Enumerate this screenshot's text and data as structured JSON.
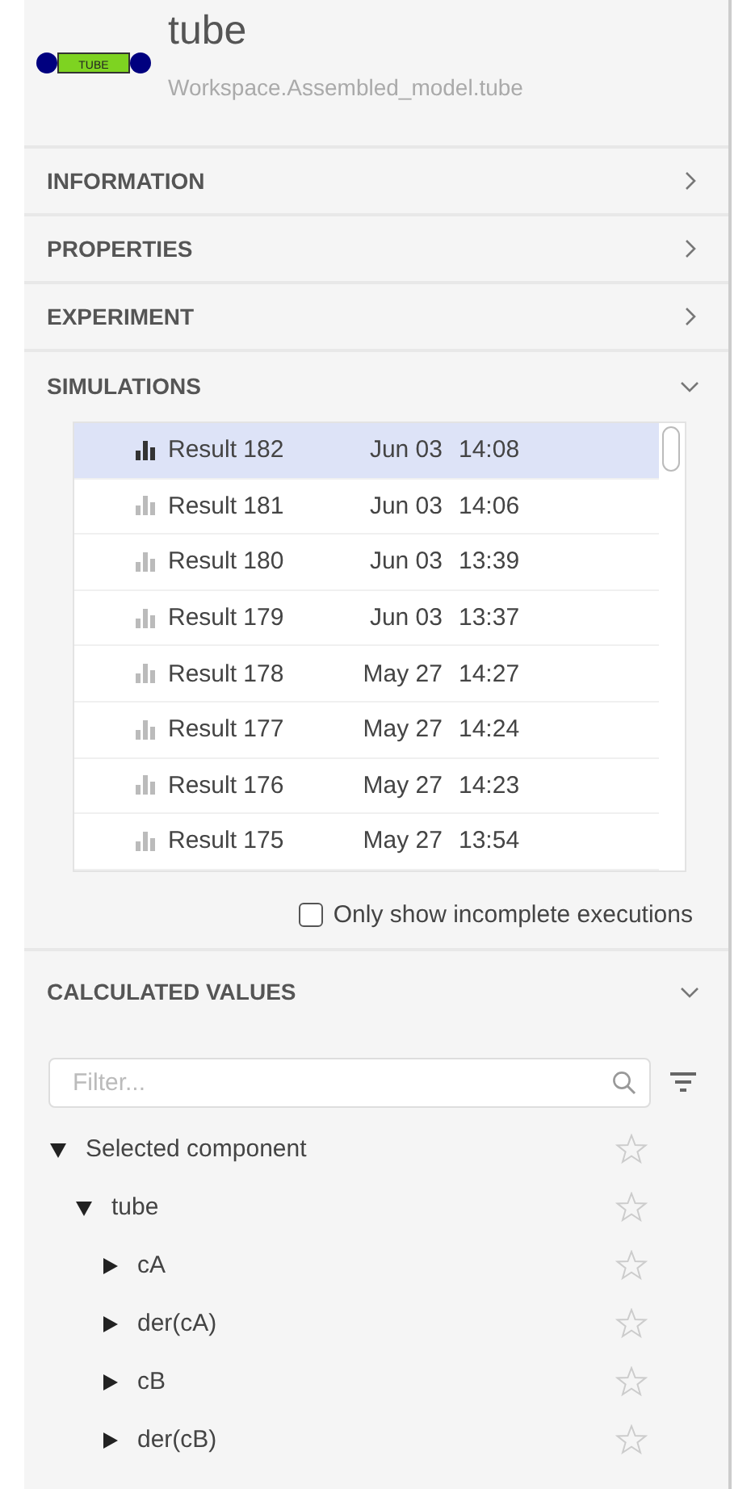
{
  "component": {
    "icon_label": "TUBE",
    "name": "tube",
    "path": "Workspace.Assembled_model.tube"
  },
  "sections": [
    {
      "title": "INFORMATION",
      "expanded": false
    },
    {
      "title": "PROPERTIES",
      "expanded": false
    },
    {
      "title": "EXPERIMENT",
      "expanded": false
    },
    {
      "title": "SIMULATIONS",
      "expanded": true
    }
  ],
  "simulations": {
    "results": [
      {
        "name": "Result 182",
        "date": "Jun 03",
        "time": "14:08",
        "selected": true
      },
      {
        "name": "Result 181",
        "date": "Jun 03",
        "time": "14:06",
        "selected": false
      },
      {
        "name": "Result 180",
        "date": "Jun 03",
        "time": "13:39",
        "selected": false
      },
      {
        "name": "Result 179",
        "date": "Jun 03",
        "time": "13:37",
        "selected": false
      },
      {
        "name": "Result 178",
        "date": "May 27",
        "time": "14:27",
        "selected": false
      },
      {
        "name": "Result 177",
        "date": "May 27",
        "time": "14:24",
        "selected": false
      },
      {
        "name": "Result 176",
        "date": "May 27",
        "time": "14:23",
        "selected": false
      },
      {
        "name": "Result 175",
        "date": "May 27",
        "time": "13:54",
        "selected": false
      }
    ],
    "incomplete_only": {
      "label": "Only show incomplete executions",
      "checked": false
    }
  },
  "calculated_values": {
    "title": "CALCULATED VALUES",
    "expanded": true,
    "filter": {
      "placeholder": "Filter..."
    },
    "tree": [
      {
        "label": "Selected component",
        "expanded": true,
        "children": [
          {
            "label": "tube",
            "expanded": true,
            "children": [
              {
                "label": "cA",
                "expanded": false
              },
              {
                "label": "der(cA)",
                "expanded": false
              },
              {
                "label": "cB",
                "expanded": false
              },
              {
                "label": "der(cB)",
                "expanded": false
              }
            ]
          }
        ]
      }
    ]
  }
}
